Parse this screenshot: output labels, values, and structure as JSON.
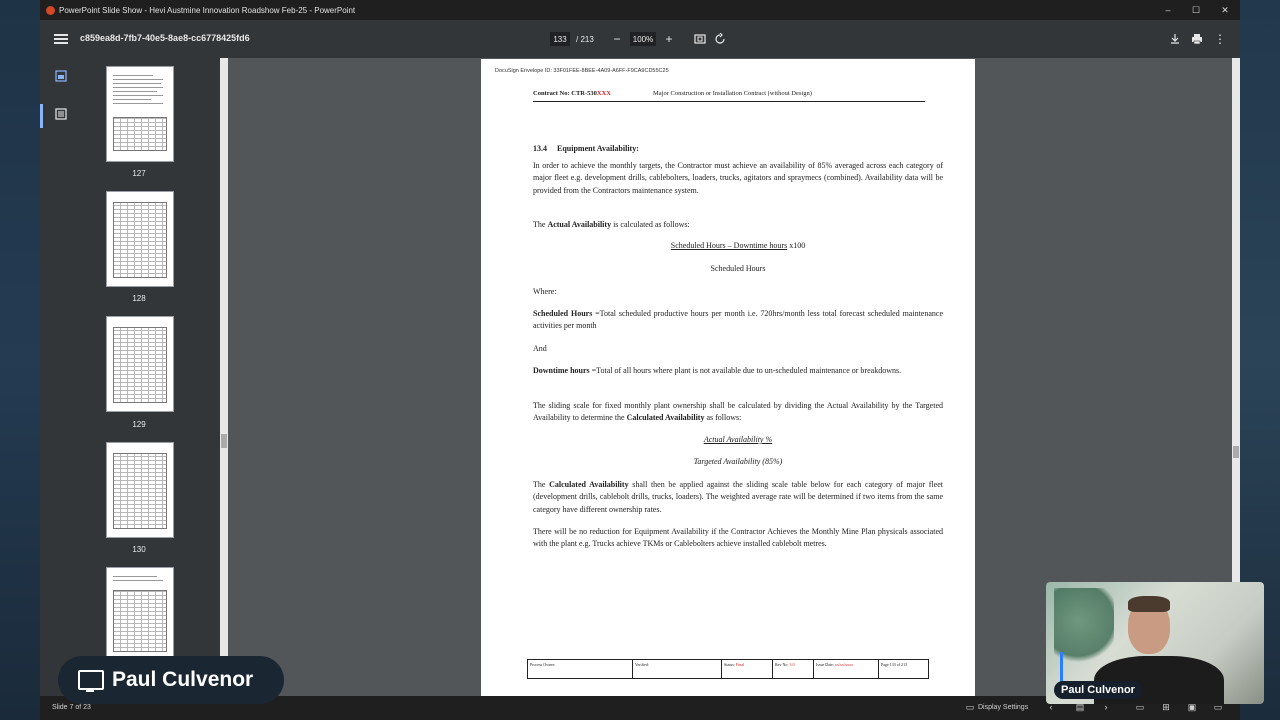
{
  "window": {
    "title": "PowerPoint Slide Show  -  Hevi Austmine Innovation Roadshow Feb-25 - PowerPoint",
    "minimize": "–",
    "maximize": "☐",
    "close": "✕"
  },
  "toolbar": {
    "doc_name": "c859ea8d-7fb7-40e5-8ae8-cc6778425fd6",
    "current_page": "133",
    "total_pages": "/ 213",
    "zoom": "100%"
  },
  "thumbnails": [
    {
      "label": "127"
    },
    {
      "label": "128"
    },
    {
      "label": "129"
    },
    {
      "label": "130"
    },
    {
      "label": ""
    }
  ],
  "page": {
    "envelope_id": "DocuSign Envelope ID: 33F01FEE-8BEE-4A09-A6FF-F9CA9CD55C25",
    "contract_no": "Contract No: CTR-530",
    "contract_xxx": "XXX",
    "contract_desc": "Major Construction or Installation Contract (without Design)",
    "section_num": "13.4",
    "section_title": "Equipment Availability:",
    "para1": "In order to achieve the monthly targets, the Contractor must achieve an availability of 85% averaged across each category of major fleet e.g. development drills, cablebolters, loaders, trucks, agitators and spraymecs (combined). Availability data will be provided from the Contractors maintenance system.",
    "actual_pre": "The ",
    "actual_bold": "Actual Availability",
    "actual_post": " is calculated as follows:",
    "formula_num": "Scheduled Hours – Downtime hours",
    "formula_x100": " x100",
    "formula_den": "Scheduled Hours",
    "where": "Where:",
    "sched_bold": "Scheduled Hours",
    "sched_text": " =Total scheduled productive hours per month  i.e. 720hrs/month less total forecast scheduled maintenance activities per month",
    "and": "And",
    "down_bold": "Downtime hours",
    "down_text": " =Total of all hours where plant is not available due to un-scheduled maintenance or breakdowns.",
    "sliding_pre": "The sliding scale   for fixed monthly plant ownership shall be calculated by dividing the Actual Availability by the Targeted Availability to determine the ",
    "sliding_bold": "Calculated Availability",
    "sliding_post": " as follows:",
    "calc_num": "Actual Availability %",
    "calc_den": "Targeted Availability (85%)",
    "calc_pre": "The ",
    "calc_bold": "Calculated Availability",
    "calc_post": " shall then be applied against the sliding scale table below for each category of major fleet (development drills, cablebolt drills, trucks, loaders). The weighted average rate will be determined if two items from the same category have different ownership rates.",
    "para_last": "There will be no reduction for Equipment Availability if the Contractor Achieves the Monthly Mine Plan physicals associated with the plant e.g. Trucks achieve TKMs or Cablebolters achieve installed cablebolt metres.",
    "footer": {
      "owner": "Process Owner:",
      "verified": "Verified:",
      "status": "Status:",
      "status_val": "Final",
      "rev": "Rev No:",
      "rev_val": "3.0",
      "issue": "Issue Date:",
      "issue_val": "xx/xx/xxxx",
      "page": "Page 133 of 213"
    }
  },
  "statusbar": {
    "slide": "Slide 7 of 23",
    "display_settings": "Display Settings"
  },
  "presenter": {
    "name": "Paul Culvenor",
    "cam_name": "Paul Culvenor"
  }
}
